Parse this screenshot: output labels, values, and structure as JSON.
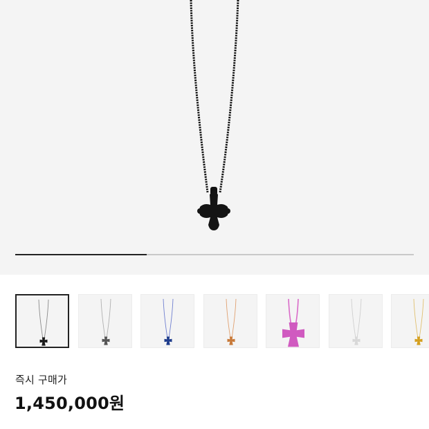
{
  "product": {
    "image_alt_icon": "cross-pendant-necklace-icon",
    "gallery_progress": 0.33
  },
  "thumbnails": [
    {
      "name": "thumbnail-black",
      "color": "#1a1a1a",
      "chain": "#8a8a8a",
      "selected": true
    },
    {
      "name": "thumbnail-gray",
      "color": "#555555",
      "chain": "#b0b0b0",
      "selected": false
    },
    {
      "name": "thumbnail-blue",
      "color": "#1e3c8c",
      "chain": "#6f7fd0",
      "selected": false
    },
    {
      "name": "thumbnail-orange",
      "color": "#c87a3a",
      "chain": "#e0a070",
      "selected": false
    },
    {
      "name": "thumbnail-pink",
      "color": "#d05ac0",
      "chain": "#d96ac8",
      "selected": false
    },
    {
      "name": "thumbnail-white",
      "color": "#d8d8d8",
      "chain": "#cfcfcf",
      "selected": false
    },
    {
      "name": "thumbnail-yellow",
      "color": "#d4a020",
      "chain": "#e0c070",
      "selected": false
    }
  ],
  "purchase": {
    "label": "즉시 구매가",
    "price": "1,450,000원"
  }
}
